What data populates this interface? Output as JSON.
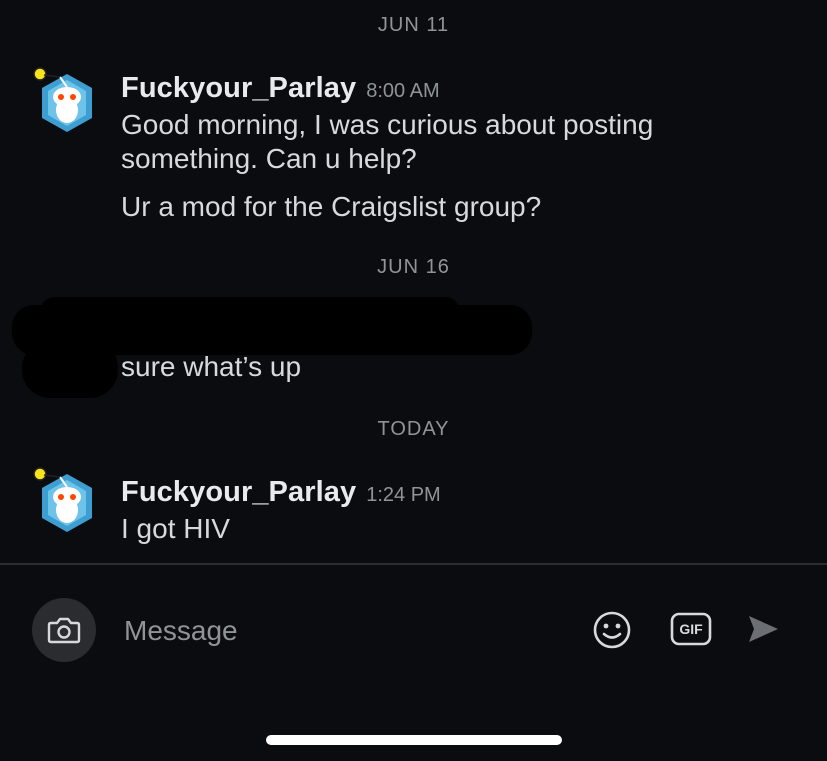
{
  "conversation": {
    "groups": [
      {
        "date": "JUN 11",
        "username": "Fuckyour_Parlay",
        "time": "8:00 AM",
        "messages": [
          "Good morning, I was curious about posting something. Can u help?",
          "Ur a mod for the Craigslist group?"
        ]
      },
      {
        "date": "JUN 16",
        "messages": [
          "sure what’s up"
        ]
      },
      {
        "date": "TODAY",
        "username": "Fuckyour_Parlay",
        "time": "1:24 PM",
        "messages": [
          "I got HIV"
        ]
      }
    ]
  },
  "composer": {
    "placeholder": "Message",
    "camera_icon": "camera-icon",
    "emoji_icon": "emoji-icon",
    "gif_label": "GIF",
    "send_icon": "send-icon"
  },
  "colors": {
    "background": "#0b0c10",
    "text": "#d7dadc",
    "muted": "#8f9499",
    "avatar_accent": "#3d9fd1"
  }
}
